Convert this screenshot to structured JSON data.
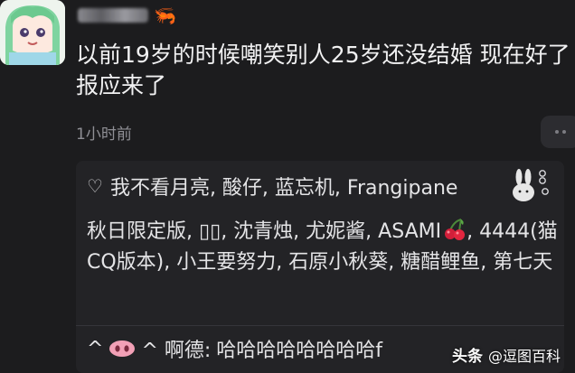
{
  "post": {
    "text": "以前19岁的时候嘲笑别人25岁还没结婚 现在好了 报应来了",
    "timestamp": "1小时前"
  },
  "likes": {
    "heart_icon": "heart-outline-icon",
    "first_line": "我不看月亮, 酸仔, 蓝忘机, Frangipane",
    "likers_text": "秋日限定版, ▯▯, 沈青烛, 尤妮酱, ASAMI",
    "likers_text_2": ", 4444(猫CQ版本), 小王要努力, 石原小秋葵, 糖醋鲤鱼, 第七天"
  },
  "comment": {
    "prefix": "^",
    "name_suffix": "^ 啊德:",
    "text": "哈哈哈哈哈哈哈哈f"
  },
  "watermark": {
    "logo": "头条",
    "handle": "@逗图百科"
  },
  "colors": {
    "background": "#1c1c1e",
    "likes_panel": "#232326",
    "timestamp": "#8f8f95"
  }
}
